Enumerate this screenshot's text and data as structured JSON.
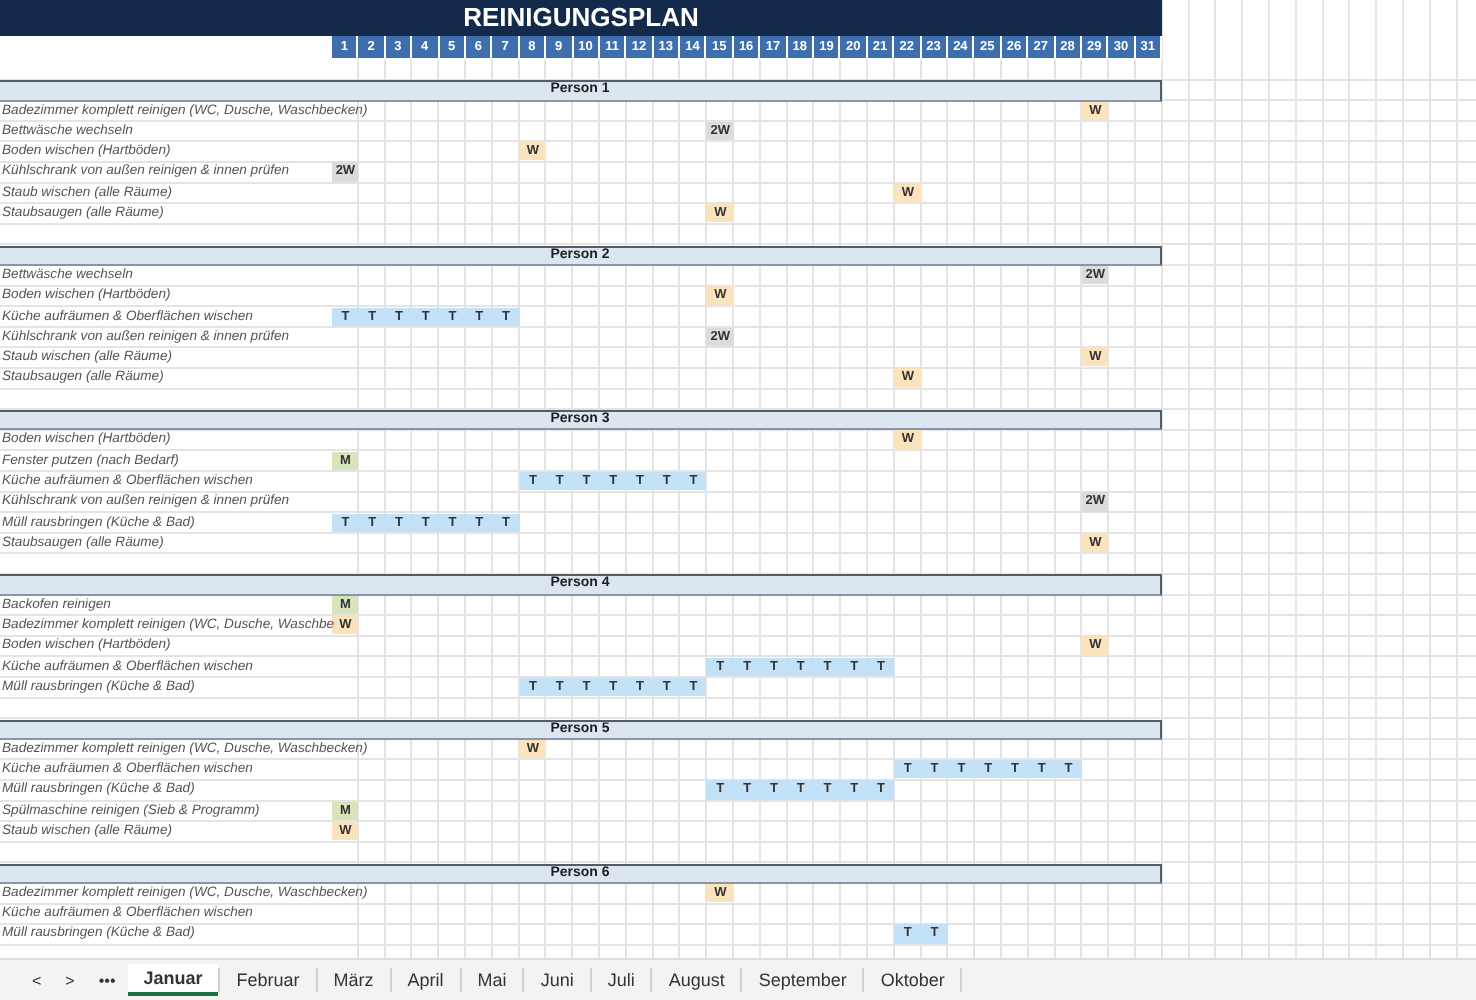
{
  "title": "REINIGUNGSPLAN",
  "days": [
    "1",
    "2",
    "3",
    "4",
    "5",
    "6",
    "7",
    "8",
    "9",
    "10",
    "11",
    "12",
    "13",
    "14",
    "15",
    "16",
    "17",
    "18",
    "19",
    "20",
    "21",
    "22",
    "23",
    "24",
    "25",
    "26",
    "27",
    "28",
    "29",
    "30",
    "31"
  ],
  "groups": [
    {
      "title": "Person 1",
      "tasks": [
        {
          "label": "Badezimmer komplett reinigen (WC, Dusche, Waschbecken)",
          "cells": [
            null,
            null,
            null,
            null,
            null,
            null,
            null,
            null,
            null,
            null,
            null,
            null,
            null,
            null,
            null,
            null,
            null,
            null,
            null,
            null,
            null,
            null,
            null,
            null,
            null,
            null,
            null,
            null,
            {
              "text": "W",
              "kind": "weekly"
            }
          ]
        },
        {
          "label": "Bettwäsche wechseln",
          "cells": [
            null,
            null,
            null,
            null,
            null,
            null,
            null,
            null,
            null,
            null,
            null,
            null,
            null,
            null,
            {
              "text": "2W",
              "kind": "biweekly"
            }
          ]
        },
        {
          "label": "Boden wischen (Hartböden)",
          "cells": [
            null,
            null,
            null,
            null,
            null,
            null,
            null,
            {
              "text": "W",
              "kind": "weekly"
            }
          ]
        },
        {
          "label": "Kühlschrank von außen reinigen & innen prüfen",
          "cells": [
            {
              "text": "2W",
              "kind": "biweekly"
            }
          ]
        },
        {
          "label": "Staub wischen (alle Räume)",
          "cells": [
            null,
            null,
            null,
            null,
            null,
            null,
            null,
            null,
            null,
            null,
            null,
            null,
            null,
            null,
            null,
            null,
            null,
            null,
            null,
            null,
            null,
            {
              "text": "W",
              "kind": "weekly"
            }
          ]
        },
        {
          "label": "Staubsaugen (alle Räume)",
          "cells": [
            null,
            null,
            null,
            null,
            null,
            null,
            null,
            null,
            null,
            null,
            null,
            null,
            null,
            null,
            {
              "text": "W",
              "kind": "weekly"
            }
          ]
        }
      ]
    },
    {
      "title": "Person 2",
      "tasks": [
        {
          "label": "Bettwäsche wechseln",
          "cells": [
            null,
            null,
            null,
            null,
            null,
            null,
            null,
            null,
            null,
            null,
            null,
            null,
            null,
            null,
            null,
            null,
            null,
            null,
            null,
            null,
            null,
            null,
            null,
            null,
            null,
            null,
            null,
            null,
            {
              "text": "2W",
              "kind": "biweekly"
            }
          ]
        },
        {
          "label": "Boden wischen (Hartböden)",
          "cells": [
            null,
            null,
            null,
            null,
            null,
            null,
            null,
            null,
            null,
            null,
            null,
            null,
            null,
            null,
            {
              "text": "W",
              "kind": "weekly"
            }
          ]
        },
        {
          "label": "Küche aufräumen & Oberflächen wischen",
          "cells": [
            {
              "text": "T",
              "kind": "daily"
            },
            {
              "text": "T",
              "kind": "daily"
            },
            {
              "text": "T",
              "kind": "daily"
            },
            {
              "text": "T",
              "kind": "daily"
            },
            {
              "text": "T",
              "kind": "daily"
            },
            {
              "text": "T",
              "kind": "daily"
            },
            {
              "text": "T",
              "kind": "daily"
            }
          ]
        },
        {
          "label": "Kühlschrank von außen reinigen & innen prüfen",
          "cells": [
            null,
            null,
            null,
            null,
            null,
            null,
            null,
            null,
            null,
            null,
            null,
            null,
            null,
            null,
            {
              "text": "2W",
              "kind": "biweekly"
            }
          ]
        },
        {
          "label": "Staub wischen (alle Räume)",
          "cells": [
            null,
            null,
            null,
            null,
            null,
            null,
            null,
            null,
            null,
            null,
            null,
            null,
            null,
            null,
            null,
            null,
            null,
            null,
            null,
            null,
            null,
            null,
            null,
            null,
            null,
            null,
            null,
            null,
            {
              "text": "W",
              "kind": "weekly"
            }
          ]
        },
        {
          "label": "Staubsaugen (alle Räume)",
          "cells": [
            null,
            null,
            null,
            null,
            null,
            null,
            null,
            null,
            null,
            null,
            null,
            null,
            null,
            null,
            null,
            null,
            null,
            null,
            null,
            null,
            null,
            {
              "text": "W",
              "kind": "weekly"
            }
          ]
        }
      ]
    },
    {
      "title": "Person 3",
      "tasks": [
        {
          "label": "Boden wischen (Hartböden)",
          "cells": [
            null,
            null,
            null,
            null,
            null,
            null,
            null,
            null,
            null,
            null,
            null,
            null,
            null,
            null,
            null,
            null,
            null,
            null,
            null,
            null,
            null,
            {
              "text": "W",
              "kind": "weekly"
            }
          ]
        },
        {
          "label": "Fenster putzen (nach Bedarf)",
          "cells": [
            {
              "text": "M",
              "kind": "monthly"
            }
          ]
        },
        {
          "label": "Küche aufräumen & Oberflächen wischen",
          "cells": [
            null,
            null,
            null,
            null,
            null,
            null,
            null,
            {
              "text": "T",
              "kind": "daily"
            },
            {
              "text": "T",
              "kind": "daily"
            },
            {
              "text": "T",
              "kind": "daily"
            },
            {
              "text": "T",
              "kind": "daily"
            },
            {
              "text": "T",
              "kind": "daily"
            },
            {
              "text": "T",
              "kind": "daily"
            },
            {
              "text": "T",
              "kind": "daily"
            }
          ]
        },
        {
          "label": "Kühlschrank von außen reinigen & innen prüfen",
          "cells": [
            null,
            null,
            null,
            null,
            null,
            null,
            null,
            null,
            null,
            null,
            null,
            null,
            null,
            null,
            null,
            null,
            null,
            null,
            null,
            null,
            null,
            null,
            null,
            null,
            null,
            null,
            null,
            null,
            {
              "text": "2W",
              "kind": "biweekly"
            }
          ]
        },
        {
          "label": "Müll rausbringen (Küche & Bad)",
          "cells": [
            {
              "text": "T",
              "kind": "daily"
            },
            {
              "text": "T",
              "kind": "daily"
            },
            {
              "text": "T",
              "kind": "daily"
            },
            {
              "text": "T",
              "kind": "daily"
            },
            {
              "text": "T",
              "kind": "daily"
            },
            {
              "text": "T",
              "kind": "daily"
            },
            {
              "text": "T",
              "kind": "daily"
            }
          ]
        },
        {
          "label": "Staubsaugen (alle Räume)",
          "cells": [
            null,
            null,
            null,
            null,
            null,
            null,
            null,
            null,
            null,
            null,
            null,
            null,
            null,
            null,
            null,
            null,
            null,
            null,
            null,
            null,
            null,
            null,
            null,
            null,
            null,
            null,
            null,
            null,
            {
              "text": "W",
              "kind": "weekly"
            }
          ]
        }
      ]
    },
    {
      "title": "Person 4",
      "tasks": [
        {
          "label": "Backofen reinigen",
          "cells": [
            {
              "text": "M",
              "kind": "monthly"
            }
          ]
        },
        {
          "label": "Badezimmer komplett reinigen (WC, Dusche, Waschbe",
          "cells": [
            {
              "text": "W",
              "kind": "weekly"
            }
          ]
        },
        {
          "label": "Boden wischen (Hartböden)",
          "cells": [
            null,
            null,
            null,
            null,
            null,
            null,
            null,
            null,
            null,
            null,
            null,
            null,
            null,
            null,
            null,
            null,
            null,
            null,
            null,
            null,
            null,
            null,
            null,
            null,
            null,
            null,
            null,
            null,
            {
              "text": "W",
              "kind": "weekly"
            }
          ]
        },
        {
          "label": "Küche aufräumen & Oberflächen wischen",
          "cells": [
            null,
            null,
            null,
            null,
            null,
            null,
            null,
            null,
            null,
            null,
            null,
            null,
            null,
            null,
            {
              "text": "T",
              "kind": "daily"
            },
            {
              "text": "T",
              "kind": "daily"
            },
            {
              "text": "T",
              "kind": "daily"
            },
            {
              "text": "T",
              "kind": "daily"
            },
            {
              "text": "T",
              "kind": "daily"
            },
            {
              "text": "T",
              "kind": "daily"
            },
            {
              "text": "T",
              "kind": "daily"
            }
          ]
        },
        {
          "label": "Müll rausbringen (Küche & Bad)",
          "cells": [
            null,
            null,
            null,
            null,
            null,
            null,
            null,
            {
              "text": "T",
              "kind": "daily"
            },
            {
              "text": "T",
              "kind": "daily"
            },
            {
              "text": "T",
              "kind": "daily"
            },
            {
              "text": "T",
              "kind": "daily"
            },
            {
              "text": "T",
              "kind": "daily"
            },
            {
              "text": "T",
              "kind": "daily"
            },
            {
              "text": "T",
              "kind": "daily"
            }
          ]
        }
      ]
    },
    {
      "title": "Person 5",
      "tasks": [
        {
          "label": "Badezimmer komplett reinigen (WC, Dusche, Waschbecken)",
          "cells": [
            null,
            null,
            null,
            null,
            null,
            null,
            null,
            {
              "text": "W",
              "kind": "weekly"
            }
          ]
        },
        {
          "label": "Küche aufräumen & Oberflächen wischen",
          "cells": [
            null,
            null,
            null,
            null,
            null,
            null,
            null,
            null,
            null,
            null,
            null,
            null,
            null,
            null,
            null,
            null,
            null,
            null,
            null,
            null,
            null,
            {
              "text": "T",
              "kind": "daily"
            },
            {
              "text": "T",
              "kind": "daily"
            },
            {
              "text": "T",
              "kind": "daily"
            },
            {
              "text": "T",
              "kind": "daily"
            },
            {
              "text": "T",
              "kind": "daily"
            },
            {
              "text": "T",
              "kind": "daily"
            },
            {
              "text": "T",
              "kind": "daily"
            }
          ]
        },
        {
          "label": "Müll rausbringen (Küche & Bad)",
          "cells": [
            null,
            null,
            null,
            null,
            null,
            null,
            null,
            null,
            null,
            null,
            null,
            null,
            null,
            null,
            {
              "text": "T",
              "kind": "daily"
            },
            {
              "text": "T",
              "kind": "daily"
            },
            {
              "text": "T",
              "kind": "daily"
            },
            {
              "text": "T",
              "kind": "daily"
            },
            {
              "text": "T",
              "kind": "daily"
            },
            {
              "text": "T",
              "kind": "daily"
            },
            {
              "text": "T",
              "kind": "daily"
            }
          ]
        },
        {
          "label": "Spülmaschine reinigen (Sieb & Programm)",
          "cells": [
            {
              "text": "M",
              "kind": "monthly"
            }
          ]
        },
        {
          "label": "Staub wischen (alle Räume)",
          "cells": [
            {
              "text": "W",
              "kind": "weekly"
            }
          ]
        }
      ]
    },
    {
      "title": "Person 6",
      "tasks": [
        {
          "label": "Badezimmer komplett reinigen (WC, Dusche, Waschbecken)",
          "cells": [
            null,
            null,
            null,
            null,
            null,
            null,
            null,
            null,
            null,
            null,
            null,
            null,
            null,
            null,
            {
              "text": "W",
              "kind": "weekly"
            }
          ]
        },
        {
          "label": "Küche aufräumen & Oberflächen wischen"
        },
        {
          "label": "Müll rausbringen (Küche & Bad)",
          "cells": [
            null,
            null,
            null,
            null,
            null,
            null,
            null,
            null,
            null,
            null,
            null,
            null,
            null,
            null,
            null,
            null,
            null,
            null,
            null,
            null,
            null,
            {
              "text": "T",
              "kind": "daily"
            },
            {
              "text": "T",
              "kind": "daily"
            }
          ]
        }
      ]
    }
  ],
  "sheet_nav": [
    "<",
    ">",
    "•••"
  ],
  "sheet_tabs": [
    {
      "label": "Januar",
      "selected": true
    },
    {
      "label": "Februar",
      "selected": false
    },
    {
      "label": "März",
      "selected": false
    },
    {
      "label": "April",
      "selected": false
    },
    {
      "label": "Mai",
      "selected": false
    },
    {
      "label": "Juni",
      "selected": false
    },
    {
      "label": "Juli",
      "selected": false
    },
    {
      "label": "August",
      "selected": false
    },
    {
      "label": "September",
      "selected": false
    },
    {
      "label": "Oktober",
      "selected": false
    }
  ]
}
